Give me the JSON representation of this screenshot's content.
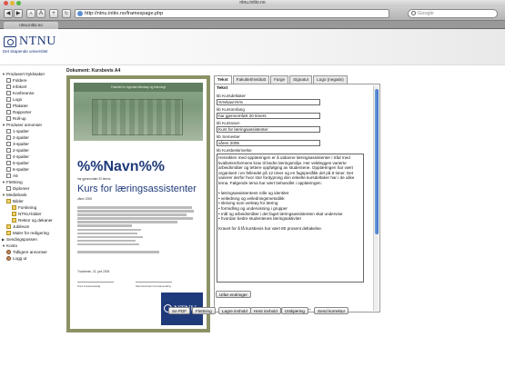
{
  "browser": {
    "window_title": "ntnu.initio.no",
    "url": "http://ntnu.initio.no/framespage.php",
    "search_placeholder": "Google",
    "tab_label": "ntnu.initio.no",
    "nav": {
      "back": "◀",
      "forward": "▶",
      "text_smaller": "A",
      "text_bigger": "A",
      "add": "+"
    }
  },
  "brand": {
    "name": "NTNU",
    "tagline": "Det skapende universitet"
  },
  "sidebar": {
    "items": [
      {
        "label": "Produsert trykksaker",
        "level": 0,
        "type": "arrow",
        "arrow": "▼"
      },
      {
        "label": "Foldere",
        "level": 1,
        "type": "doc"
      },
      {
        "label": "Infokort",
        "level": 1,
        "type": "doc"
      },
      {
        "label": "Konferanse",
        "level": 1,
        "type": "doc"
      },
      {
        "label": "Logo",
        "level": 1,
        "type": "doc"
      },
      {
        "label": "Plakater",
        "level": 1,
        "type": "doc"
      },
      {
        "label": "Rapporter",
        "level": 1,
        "type": "doc"
      },
      {
        "label": "Roll-up",
        "level": 1,
        "type": "doc"
      },
      {
        "label": "Produser annonser",
        "level": 0,
        "type": "arrow",
        "arrow": "▼"
      },
      {
        "label": "1-spalter",
        "level": 1,
        "type": "doc"
      },
      {
        "label": "2-spalter",
        "level": 1,
        "type": "doc"
      },
      {
        "label": "3-spalter",
        "level": 1,
        "type": "doc"
      },
      {
        "label": "2-spalter",
        "level": 1,
        "type": "doc"
      },
      {
        "label": "4-spalter",
        "level": 1,
        "type": "doc"
      },
      {
        "label": "5-spalter",
        "level": 1,
        "type": "doc"
      },
      {
        "label": "6-spalter",
        "level": 1,
        "type": "doc"
      },
      {
        "label": "A5",
        "level": 1,
        "type": "doc"
      },
      {
        "label": "Flettning",
        "level": 0,
        "type": "arrow",
        "arrow": "▼"
      },
      {
        "label": "Diplomer",
        "level": 1,
        "type": "doc"
      },
      {
        "label": "Mediebank",
        "level": 0,
        "type": "arrow",
        "arrow": "▼"
      },
      {
        "label": "Bilder",
        "level": 1,
        "type": "folder"
      },
      {
        "label": "Forskning",
        "level": 2,
        "type": "folder"
      },
      {
        "label": "NTNU-bilder",
        "level": 2,
        "type": "folder"
      },
      {
        "label": "Rektor og dekaner",
        "level": 2,
        "type": "folder"
      },
      {
        "label": "Jubileum",
        "level": 1,
        "type": "folder"
      },
      {
        "label": "Maler for redigering",
        "level": 1,
        "type": "folder"
      },
      {
        "label": "Sendingspossen",
        "level": 0,
        "type": "arrow",
        "arrow": "▶"
      },
      {
        "label": "Konto",
        "level": 0,
        "type": "arrow",
        "arrow": "▼"
      },
      {
        "label": "Tidligere annonser",
        "level": 1,
        "type": "person"
      },
      {
        "label": "Logg ut",
        "level": 1,
        "type": "person"
      }
    ]
  },
  "document": {
    "title": "Dokument: Kursbevis A4",
    "preview": {
      "strip_text": "Fakultet for ingeniørvitenskap og teknologi",
      "name": "%%Navn%%",
      "small1": "har gjennomført 20 timers",
      "course": "Kurs for læringsassistenter",
      "small2": "våren 2005",
      "date": "Trondheim, 22. juni 2005",
      "sig_left": "Kurs Kursansvarlig",
      "sig_right": "Ola Nordmann Kursansvarlig",
      "logo_text": "NTNU"
    }
  },
  "editor": {
    "tabs": [
      "Tekst",
      "Fakultet/Institutt",
      "Farge",
      "Signatur",
      "Logo (negativ)"
    ],
    "active_tab": "Tekst",
    "heading": "Tekst",
    "fields": [
      {
        "label": "kb Kursdeltaker",
        "value": "%%Navn%%"
      },
      {
        "label": "kb Kursomfang",
        "value": "har gjennomført 20 timers"
      },
      {
        "label": "kb Kursnavn",
        "value": "Kurs for læringsassistenter"
      },
      {
        "label": "kb Semester",
        "value": "våren 2005"
      }
    ],
    "textarea_label": "kb Kursbeskrivelse",
    "textarea_value": "Hensikten med opplæringen er å utdanne læringsassistenter i tråd med kvalitetsreformens krav til bedre læringsmiljø. Her vektlegges varierte arbeidsmåter og tettere oppfølging av studentene. Opplæringen har vært organisert i en fellesdel på 12 timer og en fagspesifikk del på 8 timer. Det varierer derfor hvor stor fordypning den enkelte kursdeltaker har i de ulike tema. Følgende tema har vært behandlet i opplæringen:\n\n• læringsassistentens rolle og identitet\n• veiledning og veiledningsmetodikk\n• skriving som verktøy for læring\n• formidling og undervisning i grupper\n• mål og arbeidsmåter i det faget læringsassistenten skal undervise\n• hvordan bedre studentenes læringsaktivitet\n\nKravet for å få kursbevis har vært 80 prosent deltakelse.",
    "utfor_button": "Utfør endringer"
  },
  "actions": [
    "Se PDF",
    "Flettning",
    "Lagre innhold",
    "Hent innhold",
    "Utskjæring",
    "Send korrektur"
  ]
}
